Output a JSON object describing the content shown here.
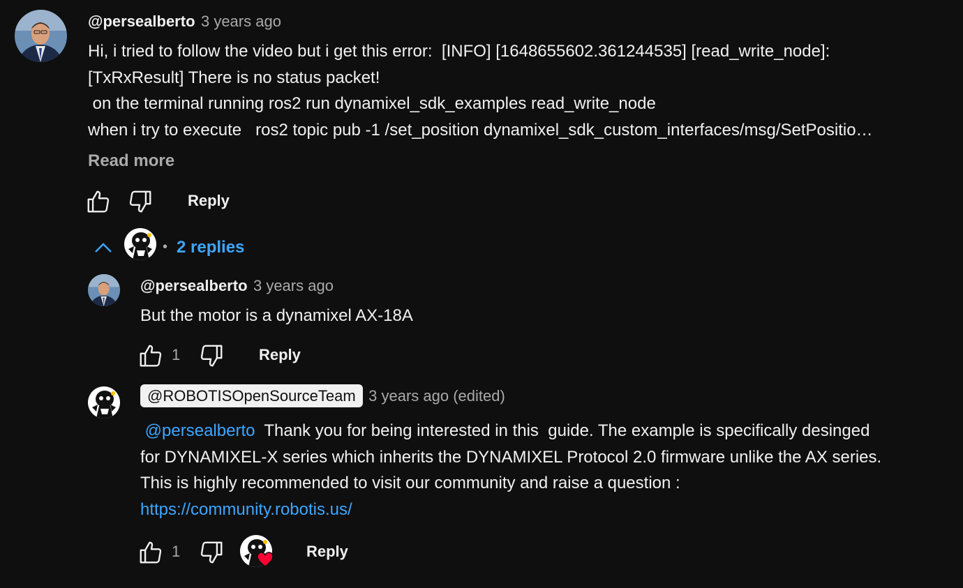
{
  "main_comment": {
    "handle": "@persealberto",
    "time": "3 years ago",
    "lines": [
      "Hi, i tried to follow the video but i get this error:  [INFO] [1648655602.361244535] [read_write_node]:",
      "[TxRxResult] There is no status packet!",
      " on the terminal running ros2 run dynamixel_sdk_examples read_write_node",
      "when i try to execute   ros2 topic pub -1 /set_position dynamixel_sdk_custom_interfaces/msg/SetPositio…"
    ],
    "read_more": "Read more",
    "reply_label": "Reply",
    "icons": {
      "like": "thumb-up-icon",
      "dislike": "thumb-down-icon"
    }
  },
  "replies_toggle": {
    "separator": "•",
    "label": "2 replies",
    "icon": "chevron-up-icon"
  },
  "replies": [
    {
      "handle": "@persealberto",
      "time": "3 years ago",
      "text": "But the motor is a dynamixel AX-18A",
      "likes": "1",
      "reply_label": "Reply"
    },
    {
      "handle": "@ROBOTISOpenSourceTeam",
      "time": "3 years ago (edited)",
      "mention": "@persealberto",
      "line1_rest": "  Thank you for being interested in this  guide. The example is specifically desinged",
      "line2": "for DYNAMIXEL-X series which inherits the DYNAMIXEL Protocol 2.0 firmware unlike the AX series.",
      "line3": "This is highly recommended to visit our community and raise a question :",
      "url": "https://community.robotis.us/",
      "likes": "1",
      "reply_label": "Reply",
      "creator_heart": "heart-icon"
    }
  ],
  "colors": {
    "background": "#0f0f0f",
    "text": "#f1f1f1",
    "secondary": "#aaaaaa",
    "link": "#3ea6ff",
    "heart": "#ff0033"
  }
}
